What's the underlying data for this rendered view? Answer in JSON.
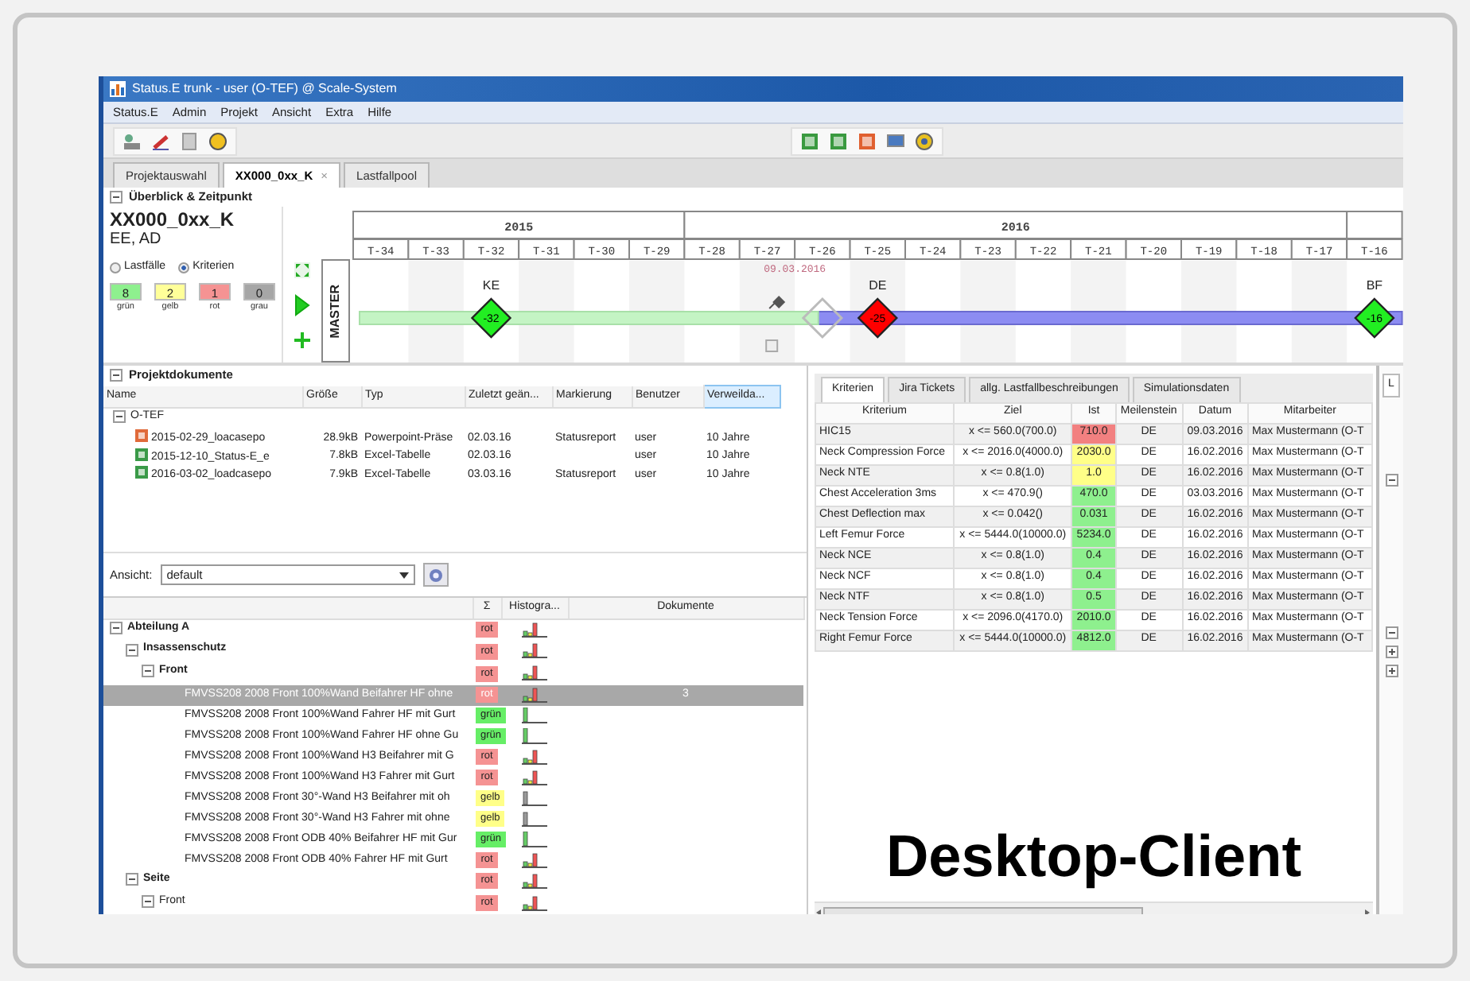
{
  "window": {
    "title": "Status.E trunk - user (O-TEF) @ Scale-System"
  },
  "menu": [
    "Status.E",
    "Admin",
    "Projekt",
    "Ansicht",
    "Extra",
    "Hilfe"
  ],
  "tabs": [
    {
      "label": "Projektauswahl",
      "selected": false
    },
    {
      "label": "XX000_0xx_K",
      "selected": true,
      "close": "×"
    },
    {
      "label": "Lastfallpool",
      "selected": false
    }
  ],
  "overview": {
    "section_title": "Überblick & Zeitpunkt",
    "expanded": true,
    "project_title": "XX000_0xx_K",
    "project_subtitle": "EE, AD",
    "radios": [
      {
        "label": "Lastfälle",
        "selected": false
      },
      {
        "label": "Kriterien",
        "selected": true
      }
    ],
    "counters": [
      {
        "value": "8",
        "label": "grün",
        "color": "#8ef08e"
      },
      {
        "value": "2",
        "label": "gelb",
        "color": "#ffff99"
      },
      {
        "value": "1",
        "label": "rot",
        "color": "#f59393"
      },
      {
        "value": "0",
        "label": "grau",
        "color": "#a6a6a6"
      }
    ],
    "master_label": "MASTER",
    "timeline": {
      "level": 0.44,
      "years": [
        {
          "label": "2015",
          "weeks": [
            {
              "label": "T-34"
            },
            {
              "label": "T-33"
            },
            {
              "label": "T-32",
              "milestone": {
                "label": "KE",
                "value": "-32",
                "color": "#22ee22"
              }
            },
            {
              "label": "T-31"
            },
            {
              "label": "T-30"
            },
            {
              "label": "T-29"
            }
          ]
        },
        {
          "label": "2016",
          "weeks": [
            {
              "label": "T-28"
            },
            {
              "label": "T-27"
            },
            {
              "label": "T-26",
              "date_marker": "09.03.2016",
              "previous_milestone": true
            },
            {
              "label": "T-25",
              "milestone": {
                "label": "DE",
                "value": "-25",
                "color": "#ff0000"
              }
            },
            {
              "label": "T-24"
            },
            {
              "label": "T-23"
            },
            {
              "label": "T-22"
            },
            {
              "label": "T-21"
            },
            {
              "label": "T-20"
            },
            {
              "label": "T-19"
            },
            {
              "label": "T-18"
            },
            {
              "label": "T-17"
            }
          ]
        },
        {
          "weeks": [
            {
              "label": "T-16",
              "milestone": {
                "label": "BF",
                "value": "-16",
                "color": "#22ee22"
              }
            }
          ]
        }
      ]
    }
  },
  "documents": {
    "title": "Projektdokumente",
    "expanded": true,
    "columns": [
      {
        "label": "Name",
        "selected": false
      },
      {
        "label": "Größe",
        "selected": false
      },
      {
        "label": "Typ",
        "selected": false
      },
      {
        "label": "Zuletzt geän...",
        "selected": false
      },
      {
        "label": "Markierung",
        "selected": false
      },
      {
        "label": "Benutzer",
        "selected": false
      },
      {
        "label": "Verweilda...",
        "selected": true
      }
    ],
    "folder": {
      "name": "O-TEF",
      "expanded": true,
      "children": [
        {
          "kind": "ppt",
          "name": "2015-02-29_loacasepo",
          "size": "28.9kB",
          "type": "Powerpoint-Präse",
          "modified": "02.03.16",
          "marking": "Statusreport",
          "user": "user",
          "retention": "10 Jahre"
        },
        {
          "kind": "xls",
          "name": "2015-12-10_Status-E_e",
          "size": "7.8kB",
          "type": "Excel-Tabelle",
          "modified": "02.03.16",
          "user": "user",
          "retention": "10 Jahre"
        },
        {
          "kind": "xls",
          "name": "2016-03-02_loadcasepo",
          "size": "7.9kB",
          "type": "Excel-Tabelle",
          "modified": "03.03.16",
          "marking": "Statusreport",
          "user": "user",
          "retention": "10 Jahre"
        }
      ]
    }
  },
  "view": {
    "label": "Ansicht:",
    "value": "default"
  },
  "tree": {
    "columns": [
      "Σ",
      "Histogra...",
      "Dokumente"
    ],
    "nodes": [
      {
        "label": "Abteilung A",
        "status": "rot",
        "color": "#f59393",
        "expanded": true,
        "selected": false,
        "children": [
          {
            "label": "Insassenschutz",
            "status": "rot",
            "color": "#f59393",
            "expanded": true,
            "selected": false,
            "children": [
              {
                "label": "Front",
                "status": "rot",
                "color": "#f59393",
                "expanded": true,
                "selected": false,
                "children": [
                  {
                    "label": "FMVSS208 2008 Front 100%Wand Beifahrer HF ohne",
                    "status": "rot",
                    "color": "#f59393",
                    "selected": true,
                    "documents": "3"
                  },
                  {
                    "label": "FMVSS208 2008 Front 100%Wand Fahrer HF mit Gurt",
                    "status": "grün",
                    "color": "#66ee66",
                    "selected": false
                  },
                  {
                    "label": "FMVSS208 2008 Front 100%Wand Fahrer HF ohne Gu",
                    "status": "grün",
                    "color": "#66ee66",
                    "selected": false
                  },
                  {
                    "label": "FMVSS208 2008 Front 100%Wand H3 Beifahrer mit G",
                    "status": "rot",
                    "color": "#f59393",
                    "selected": false
                  },
                  {
                    "label": "FMVSS208 2008 Front 100%Wand H3 Fahrer mit Gurt",
                    "status": "rot",
                    "color": "#f59393",
                    "selected": false
                  },
                  {
                    "label": "FMVSS208 2008 Front 30°-Wand H3 Beifahrer mit oh",
                    "status": "gelb",
                    "color": "#ffff88",
                    "selected": false
                  },
                  {
                    "label": "FMVSS208 2008 Front 30°-Wand H3 Fahrer mit ohne",
                    "status": "gelb",
                    "color": "#ffff88",
                    "selected": false
                  },
                  {
                    "label": "FMVSS208 2008 Front ODB 40% Beifahrer HF mit Gur",
                    "status": "grün",
                    "color": "#66ee66",
                    "selected": false
                  },
                  {
                    "label": "FMVSS208 2008 Front ODB 40% Fahrer HF mit Gurt",
                    "status": "rot",
                    "color": "#f59393",
                    "selected": false
                  }
                ]
              }
            ]
          },
          {
            "label": "Seite",
            "status": "rot",
            "color": "#f59393",
            "expanded": true,
            "selected": false,
            "children": [
              {
                "label": "Front",
                "status": "rot",
                "color": "#f59393",
                "expanded": true,
                "selected": false
              }
            ]
          }
        ]
      }
    ]
  },
  "criteria": {
    "tabs": [
      {
        "label": "Kriterien",
        "selected": true
      },
      {
        "label": "Jira Tickets",
        "selected": false
      },
      {
        "label": "allg. Lastfallbeschreibungen",
        "selected": false
      },
      {
        "label": "Simulationsdaten",
        "selected": false
      }
    ],
    "columns": [
      "Kriterium",
      "Ziel",
      "Ist",
      "Meilenstein",
      "Datum",
      "Mitarbeiter"
    ],
    "rows": [
      {
        "criterion": "HIC15",
        "target": "x <= 560.0(700.0)",
        "actual": "710.0",
        "color": "#f28080",
        "milestone": "DE",
        "date": "09.03.2016",
        "employee": "Max Mustermann (O-T"
      },
      {
        "criterion": "Neck Compression Force",
        "target": "x <= 2016.0(4000.0)",
        "actual": "2030.0",
        "color": "#ffff88",
        "milestone": "DE",
        "date": "16.02.2016",
        "employee": "Max Mustermann (O-T"
      },
      {
        "criterion": "Neck NTE",
        "target": "x <= 0.8(1.0)",
        "actual": "1.0",
        "color": "#ffff88",
        "milestone": "DE",
        "date": "16.02.2016",
        "employee": "Max Mustermann (O-T"
      },
      {
        "criterion": "Chest Acceleration 3ms",
        "target": "x <= 470.9()",
        "actual": "470.0",
        "color": "#8ef08e",
        "milestone": "DE",
        "date": "03.03.2016",
        "employee": "Max Mustermann (O-T"
      },
      {
        "criterion": "Chest Deflection max",
        "target": "x <= 0.042()",
        "actual": "0.031",
        "color": "#8ef08e",
        "milestone": "DE",
        "date": "16.02.2016",
        "employee": "Max Mustermann (O-T"
      },
      {
        "criterion": "Left Femur Force",
        "target": "x <= 5444.0(10000.0)",
        "actual": "5234.0",
        "color": "#8ef08e",
        "milestone": "DE",
        "date": "16.02.2016",
        "employee": "Max Mustermann (O-T"
      },
      {
        "criterion": "Neck NCE",
        "target": "x <= 0.8(1.0)",
        "actual": "0.4",
        "color": "#8ef08e",
        "milestone": "DE",
        "date": "16.02.2016",
        "employee": "Max Mustermann (O-T"
      },
      {
        "criterion": "Neck NCF",
        "target": "x <= 0.8(1.0)",
        "actual": "0.4",
        "color": "#8ef08e",
        "milestone": "DE",
        "date": "16.02.2016",
        "employee": "Max Mustermann (O-T"
      },
      {
        "criterion": "Neck NTF",
        "target": "x <= 0.8(1.0)",
        "actual": "0.5",
        "color": "#8ef08e",
        "milestone": "DE",
        "date": "16.02.2016",
        "employee": "Max Mustermann (O-T"
      },
      {
        "criterion": "Neck Tension Force",
        "target": "x <= 2096.0(4170.0)",
        "actual": "2010.0",
        "color": "#8ef08e",
        "milestone": "DE",
        "date": "16.02.2016",
        "employee": "Max Mustermann (O-T"
      },
      {
        "criterion": "Right Femur Force",
        "target": "x <= 5444.0(10000.0)",
        "actual": "4812.0",
        "color": "#8ef08e",
        "milestone": "DE",
        "date": "16.02.2016",
        "employee": "Max Mustermann (O-T"
      }
    ]
  },
  "side_panel": {
    "tab_label": "L"
  },
  "caption": "Desktop-Client"
}
